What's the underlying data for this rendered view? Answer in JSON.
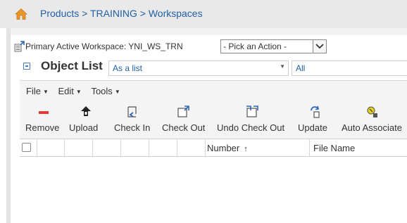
{
  "breadcrumb": {
    "items": [
      "Products",
      "TRAINING",
      "Workspaces"
    ],
    "separator": ">"
  },
  "workspace": {
    "label": "Primary Active Workspace: YNI_WS_TRN",
    "action_select": "- Pick an Action -"
  },
  "object_list": {
    "title": "Object List",
    "view": "As a list",
    "filter": "All"
  },
  "menus": [
    "File",
    "Edit",
    "Tools"
  ],
  "toolbar": [
    {
      "label": "Remove",
      "icon": "remove-icon"
    },
    {
      "label": "Upload",
      "icon": "upload-icon"
    },
    {
      "label": "Check In",
      "icon": "check-in-icon"
    },
    {
      "label": "Check Out",
      "icon": "check-out-icon"
    },
    {
      "label": "Undo Check Out",
      "icon": "undo-check-out-icon"
    },
    {
      "label": "Update",
      "icon": "update-icon"
    },
    {
      "label": "Auto Associate",
      "icon": "auto-associate-icon"
    }
  ],
  "table": {
    "columns": [
      "Number",
      "File Name"
    ],
    "sort_indicator": "↑"
  },
  "colors": {
    "link": "#1f5fa6",
    "home_icon": "#e8972a",
    "remove_red": "#e23b3b"
  }
}
